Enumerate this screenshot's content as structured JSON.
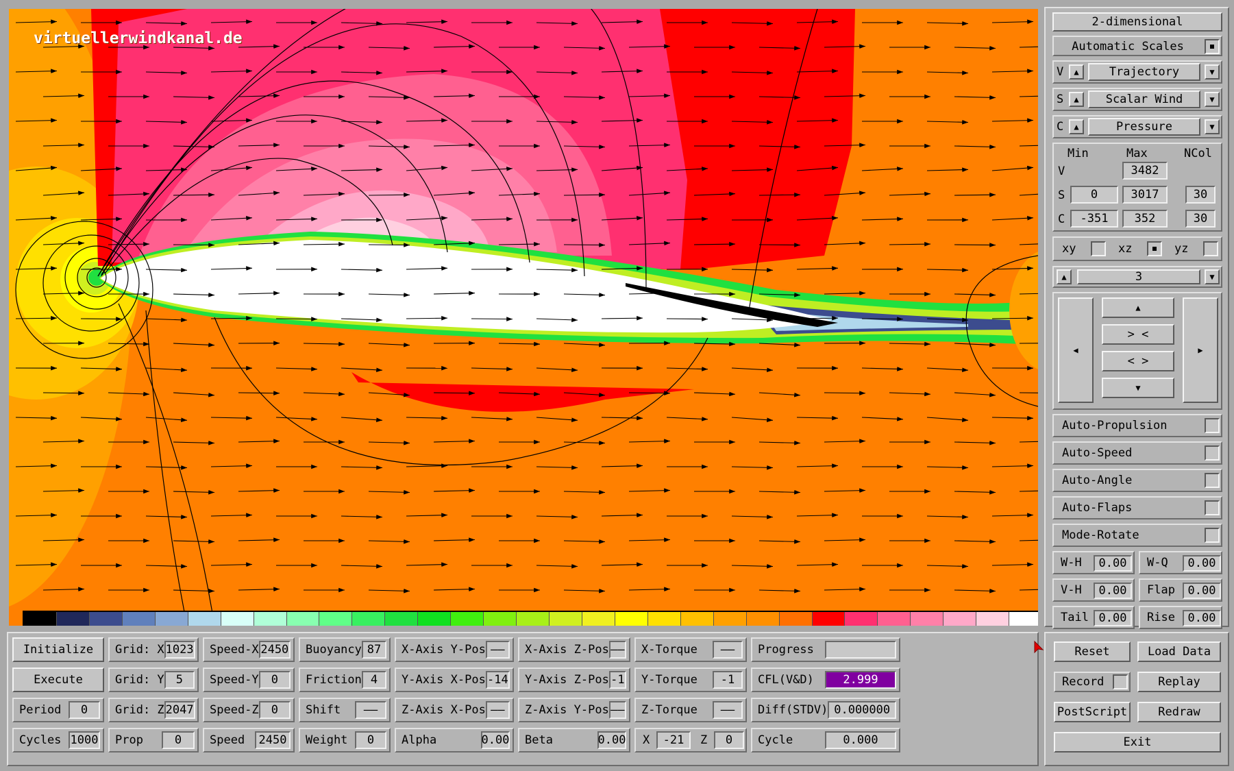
{
  "watermark": "virtuellerwindkanal.de",
  "colors": {
    "background": "#ff8000",
    "colorbar": [
      "#000000",
      "#20285a",
      "#3c4c8e",
      "#6080bc",
      "#88a8d4",
      "#b0d8ec",
      "#d8fff8",
      "#b0ffd8",
      "#88ffb0",
      "#60ff88",
      "#38f060",
      "#20e040",
      "#10e020",
      "#40f010",
      "#80f010",
      "#a8f018",
      "#d0f020",
      "#f0f020",
      "#ffff00",
      "#ffe000",
      "#ffc000",
      "#ffa000",
      "#ff9000",
      "#ff7000",
      "#ff0000",
      "#ff3070",
      "#ff6090",
      "#ff80a8",
      "#ffa8c8",
      "#ffd0e0",
      "#ffffff"
    ]
  },
  "right": {
    "mode": "2-dimensional",
    "auto_scales": "Automatic Scales",
    "rows": [
      {
        "tag": "V",
        "value": "Trajectory"
      },
      {
        "tag": "S",
        "value": "Scalar Wind"
      },
      {
        "tag": "C",
        "value": "Pressure"
      }
    ],
    "scale_headers": {
      "min": "Min",
      "max": "Max",
      "ncol": "NCol"
    },
    "scales": [
      {
        "tag": "V",
        "min": "",
        "max": "3482",
        "ncol": ""
      },
      {
        "tag": "S",
        "min": "0",
        "max": "3017",
        "ncol": "30"
      },
      {
        "tag": "C",
        "min": "-351",
        "max": "352",
        "ncol": "30"
      }
    ],
    "planes": [
      "xy",
      "xz",
      "yz"
    ],
    "plane_selected": "xz",
    "layer": "3",
    "nav": {
      "up": "▲",
      "zoom_in": "> <",
      "zoom_out": "< >",
      "down": "▼",
      "left": "◀",
      "right": "▶"
    },
    "toggles": [
      "Auto-Propulsion",
      "Auto-Speed",
      "Auto-Angle",
      "Auto-Flaps",
      "Mode-Rotate"
    ],
    "params": [
      {
        "l1": "W-H",
        "v1": "0.00",
        "l2": "W-Q",
        "v2": "0.00"
      },
      {
        "l1": "V-H",
        "v1": "0.00",
        "l2": "Flap",
        "v2": "0.00"
      },
      {
        "l1": "Tail",
        "v1": "0.00",
        "l2": "Rise",
        "v2": "0.00"
      }
    ]
  },
  "bottom": {
    "col1": [
      {
        "label": "Initialize"
      },
      {
        "label": "Execute"
      },
      {
        "label": "Period",
        "value": "0"
      },
      {
        "label": "Cycles",
        "value": "1000"
      }
    ],
    "col2": [
      {
        "label": "Grid: X",
        "value": "1023"
      },
      {
        "label": "Grid: Y",
        "value": "5"
      },
      {
        "label": "Grid: Z",
        "value": "2047"
      },
      {
        "label": "Prop",
        "value": "0"
      }
    ],
    "col3": [
      {
        "label": "Speed-X",
        "value": "2450"
      },
      {
        "label": "Speed-Y",
        "value": "0"
      },
      {
        "label": "Speed-Z",
        "value": "0"
      },
      {
        "label": "Speed",
        "value": "2450"
      }
    ],
    "col4": [
      {
        "label": "Buoyancy",
        "value": "87"
      },
      {
        "label": "Friction",
        "value": "4"
      },
      {
        "label": "Shift",
        "value": "——"
      },
      {
        "label": "Weight",
        "value": "0"
      }
    ],
    "col5": [
      {
        "label": "X-Axis Y-Pos",
        "value": "——"
      },
      {
        "label": "Y-Axis X-Pos",
        "value": "-14"
      },
      {
        "label": "Z-Axis X-Pos",
        "value": "——"
      },
      {
        "label": "Alpha",
        "value": "0.00"
      }
    ],
    "col6": [
      {
        "label": "X-Axis Z-Pos",
        "value": "——"
      },
      {
        "label": "Y-Axis Z-Pos",
        "value": "-1"
      },
      {
        "label": "Z-Axis Y-Pos",
        "value": "——"
      },
      {
        "label": "Beta",
        "value": "0.00"
      }
    ],
    "col7": [
      {
        "label": "X-Torque",
        "value": "——"
      },
      {
        "label": "Y-Torque",
        "value": "-1"
      },
      {
        "label": "Z-Torque",
        "value": "——"
      }
    ],
    "col7_last": {
      "x_label": "X",
      "x_value": "-21",
      "z_label": "Z",
      "z_value": "0"
    },
    "col8": [
      {
        "label": "Progress",
        "value": ""
      },
      {
        "label": "CFL(V&D)",
        "value": "2.999"
      },
      {
        "label": "Diff(STDV)",
        "value": "0.000000"
      },
      {
        "label": "Cycle",
        "value": "0.000"
      }
    ],
    "progress_fraction": 0.0,
    "buttons": {
      "reset": "Reset",
      "load_data": "Load Data",
      "record": "Record",
      "replay": "Replay",
      "postscript": "PostScript",
      "redraw": "Redraw",
      "exit": "Exit"
    }
  }
}
